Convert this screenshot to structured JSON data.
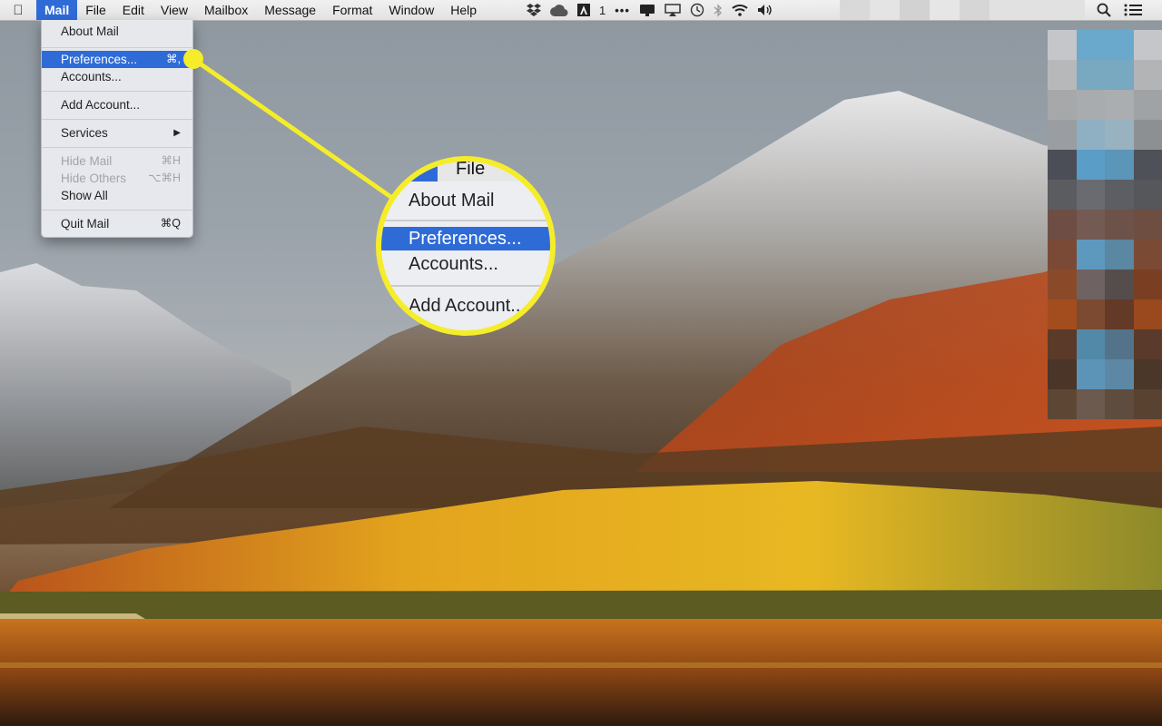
{
  "menubar": {
    "apple_icon": "apple-icon",
    "menus": [
      "Mail",
      "File",
      "Edit",
      "View",
      "Mailbox",
      "Message",
      "Format",
      "Window",
      "Help"
    ],
    "active_menu": "Mail",
    "status_items": {
      "notification_count": "1",
      "icons": [
        "dropbox-icon",
        "cloud-icon",
        "adobe-icon",
        "ellipsis-icon",
        "display-icon",
        "airplay-icon",
        "time-machine-icon",
        "bluetooth-icon",
        "wifi-icon",
        "volume-icon",
        "spotlight-icon",
        "notification-center-icon"
      ]
    }
  },
  "mail_menu": {
    "items": [
      {
        "label": "About Mail",
        "shortcut": "",
        "state": "normal"
      },
      {
        "label": "Preferences...",
        "shortcut": "⌘,",
        "state": "highlighted"
      },
      {
        "label": "Accounts...",
        "shortcut": "",
        "state": "normal"
      },
      {
        "label": "Add Account...",
        "shortcut": "",
        "state": "normal"
      },
      {
        "label": "Services",
        "shortcut": "▶",
        "state": "submenu"
      },
      {
        "label": "Hide Mail",
        "shortcut": "⌘H",
        "state": "disabled"
      },
      {
        "label": "Hide Others",
        "shortcut": "⌥⌘H",
        "state": "disabled"
      },
      {
        "label": "Show All",
        "shortcut": "",
        "state": "normal"
      },
      {
        "label": "Quit Mail",
        "shortcut": "⌘Q",
        "state": "normal"
      }
    ]
  },
  "zoom_callout": {
    "menu_label": "File",
    "items": [
      "About Mail",
      "Preferences...",
      "Accounts...",
      "Add Account..."
    ],
    "highlight_color": "#f5ed2a"
  },
  "colors": {
    "menu_highlight": "#2f6bd6",
    "callout_yellow": "#f5ed2a"
  }
}
